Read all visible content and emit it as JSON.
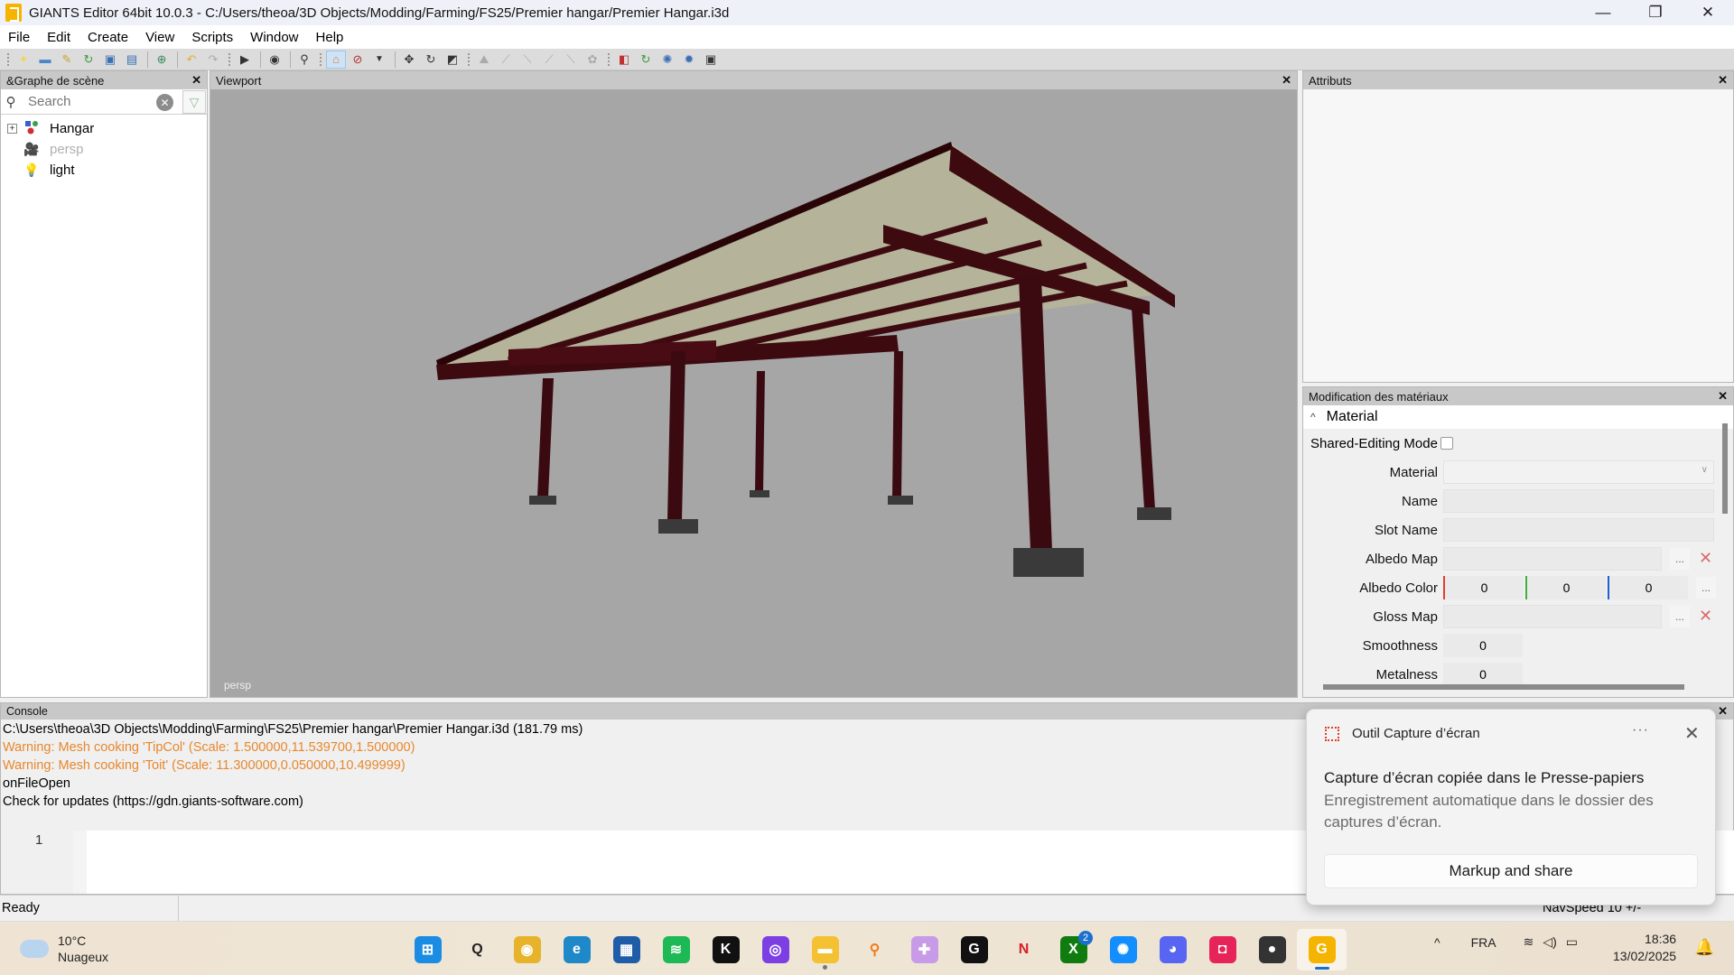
{
  "window": {
    "title": "GIANTS Editor 64bit 10.0.3 - C:/Users/theoa/3D Objects/Modding/Farming/FS25/Premier hangar/Premier Hangar.i3d",
    "minimize": "—",
    "maximize": "❐",
    "close": "✕"
  },
  "menu": [
    "File",
    "Edit",
    "Create",
    "View",
    "Scripts",
    "Window",
    "Help"
  ],
  "toolbar": {
    "icons": [
      "new-file",
      "open-folder",
      "edit",
      "reload",
      "save",
      "save-as",
      "import",
      "undo",
      "redo",
      "play",
      "visibility",
      "zoom",
      "select-mode",
      "no-select",
      "dropdown",
      "move",
      "rotate",
      "scale",
      "terrain-1",
      "terrain-2",
      "terrain-3",
      "terrain-4",
      "terrain-5",
      "terrain-6",
      "material",
      "refresh",
      "tool-a",
      "tool-b",
      "tool-c"
    ]
  },
  "scene_graph": {
    "title": "&Graphe de scène",
    "close": "✕",
    "search_placeholder": "Search",
    "items": [
      {
        "label": "Hangar",
        "icon": "transform-group",
        "expandable": true,
        "expand_glyph": "+"
      },
      {
        "label": "persp",
        "icon": "camera",
        "dimmed": true
      },
      {
        "label": "light",
        "icon": "light-bulb"
      }
    ]
  },
  "viewport": {
    "title": "Viewport",
    "close": "✕",
    "camera_label": "persp",
    "colors": {
      "background": "#a6a6a6",
      "steel": "#3d0a10",
      "roof": "#b8b79c",
      "footing": "#3a3a3a"
    }
  },
  "attributes": {
    "title": "Attributs",
    "close": "✕"
  },
  "material_editor": {
    "title": "Modification des matériaux",
    "close": "✕",
    "section": "Material",
    "section_chevron": "^",
    "shared_editing_label": "Shared-Editing Mode",
    "shared_editing_checked": false,
    "fields": {
      "material": "Material",
      "name": "Name",
      "slot_name": "Slot Name",
      "albedo_map": "Albedo Map",
      "albedo_color": "Albedo Color",
      "gloss_map": "Gloss Map",
      "smoothness": "Smoothness",
      "metalness": "Metalness"
    },
    "values": {
      "albedo_r": "0",
      "albedo_g": "0",
      "albedo_b": "0",
      "smoothness": "0",
      "metalness": "0"
    },
    "browse": "...",
    "clear": "✕"
  },
  "console": {
    "title": "Console",
    "close": "✕",
    "lines": [
      {
        "text": "C:\\Users\\theoa\\3D Objects\\Modding\\Farming\\FS25\\Premier hangar\\Premier Hangar.i3d (181.79 ms)",
        "type": "info"
      },
      {
        "text": "Warning: Mesh cooking 'TipCol' (Scale: 1.500000,11.539700,1.500000)",
        "type": "warning"
      },
      {
        "text": "Warning: Mesh cooking 'Toit' (Scale: 11.300000,0.050000,10.499999)",
        "type": "warning"
      },
      {
        "text": "onFileOpen",
        "type": "info"
      },
      {
        "text": "Check for updates (https://gdn.giants-software.com)",
        "type": "info"
      }
    ],
    "line_number": "1"
  },
  "status": {
    "ready": "Ready",
    "navspeed": "NavSpeed 10 +/-"
  },
  "toast": {
    "app": "Outil Capture d’écran",
    "more": "···",
    "close": "✕",
    "title": "Capture d’écran copiée dans le Presse-papiers",
    "body": "Enregistrement automatique dans le dossier des captures d’écran.",
    "button": "Markup and share"
  },
  "taskbar": {
    "weather_temp": "10°C",
    "weather_desc": "Nuageux",
    "apps": [
      {
        "name": "start",
        "glyph": "⊞",
        "color": "#1b8ce3"
      },
      {
        "name": "search",
        "glyph": "Q",
        "color": "transparent"
      },
      {
        "name": "chrome",
        "glyph": "◉",
        "color": "#e6b32a"
      },
      {
        "name": "edge",
        "glyph": "e",
        "color": "#1e88c8"
      },
      {
        "name": "store",
        "glyph": "▦",
        "color": "#1f5da8"
      },
      {
        "name": "spotify",
        "glyph": "≋",
        "color": "#1db954"
      },
      {
        "name": "k-app",
        "glyph": "K",
        "color": "#111111"
      },
      {
        "name": "proton",
        "glyph": "◎",
        "color": "#7b3fe4"
      },
      {
        "name": "file-explorer",
        "glyph": "▬",
        "color": "#f3c131",
        "dot": true
      },
      {
        "name": "magnifier",
        "glyph": "⚲",
        "color": "transparent"
      },
      {
        "name": "gamepad",
        "glyph": "✚",
        "color": "#c79be8"
      },
      {
        "name": "g-hub",
        "glyph": "G",
        "color": "#111111"
      },
      {
        "name": "netflix",
        "glyph": "N",
        "color": "transparent"
      },
      {
        "name": "xbox",
        "glyph": "X",
        "color": "#107c10",
        "badge": "2"
      },
      {
        "name": "battle-net",
        "glyph": "✺",
        "color": "#148eff"
      },
      {
        "name": "discord",
        "glyph": "◕",
        "color": "#5865f2"
      },
      {
        "name": "app-red",
        "glyph": "◘",
        "color": "#e6245a"
      },
      {
        "name": "fl-studio",
        "glyph": "●",
        "color": "#333333"
      },
      {
        "name": "giants-editor",
        "glyph": "G",
        "color": "#f5b400",
        "active": true
      }
    ],
    "tray_chevron": "^",
    "language": "FRA",
    "wifi": "≋",
    "volume": "◁)",
    "battery": "▭",
    "time": "18:36",
    "date": "13/02/2025",
    "notification": "🔔"
  }
}
